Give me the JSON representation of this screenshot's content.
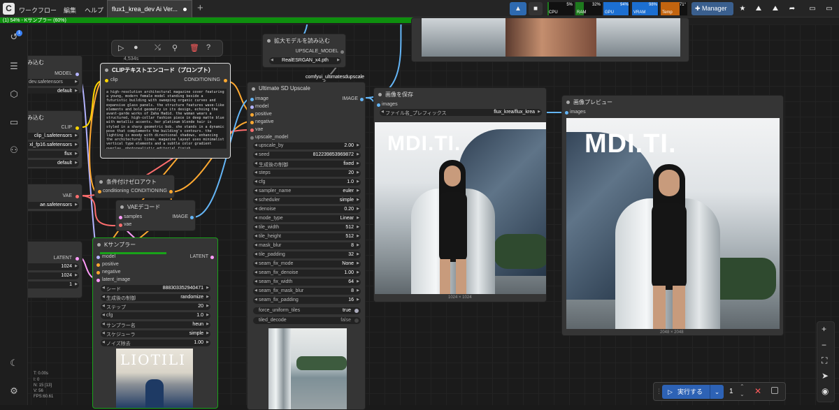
{
  "menu": {
    "app_logo": "C",
    "items": [
      "ワークフロー",
      "編集",
      "ヘルプ"
    ]
  },
  "tab": {
    "title": "flux1_krea_dev Ai Ver..."
  },
  "monitors": [
    {
      "label": "CPU",
      "pct": "5%",
      "color": "#1e7a1e"
    },
    {
      "label": "RAM",
      "pct": "32%",
      "color": "#1e7a1e"
    },
    {
      "label": "GPU",
      "pct": "94%",
      "color": "#1c6fd1"
    },
    {
      "label": "VRAM",
      "pct": "98%",
      "color": "#1c6fd1"
    },
    {
      "label": "Temp",
      "pct": "71°",
      "color": "#c2640f"
    }
  ],
  "manager": {
    "label": "Manager"
  },
  "progress": {
    "text": "(1) 54% - Kサンプラー (60%)",
    "value": 0.54
  },
  "stats": [
    "T: 0.00s",
    "I: 0",
    "N: 15 [13]",
    "V: 56",
    "FPS:60.61"
  ],
  "sidebar": {
    "badge": "1"
  },
  "canvas": {
    "edge_label": "comfyui_ultimatesdupscale",
    "clip_badge": "4,534s",
    "left_nodes": {
      "n1": {
        "title": "み込む",
        "port": "MODEL",
        "w1": "dev.safetensors",
        "w2": "default"
      },
      "n2": {
        "title": "み込む",
        "port": "CLIP",
        "w1": "clip_l.safetensors",
        "w2": "xl_fp16.safetensors",
        "w3": "flux",
        "w4": "default"
      },
      "n3": {
        "port": "VAE",
        "w1": "ae.safetensors"
      },
      "n4": {
        "port": "LATENT",
        "w1": "1024",
        "w2": "1024",
        "w3": "1"
      }
    },
    "clip_node": {
      "title": "CLIPテキストエンコード（プロンプト）",
      "in": "clip",
      "out": "CONDITIONING",
      "text": "a high-resolution architectural magazine cover featuring a young, modern female model standing beside a futuristic building with sweeping organic curves and expansive glass panels. the structure features wave-like elements and bold geometry in its design, echoing the avant-garde works of Zaha Hadid. the woman wears a structured, high-collar fashion piece in deep matte blue with metallic accents. her platinum blonde hair is styled in a sharp geometric bob. she stands in a dynamic pose that complements the building's contours. the lighting is moody with directional shadows, enhancing the architectural lines. magazine layout uses minimalist vertical type elements and a subtle color gradient overlay. photorealistic editorial finish"
    },
    "zero_node": {
      "title": "条件付けゼロアウト",
      "in": "conditioning",
      "out": "CONDITIONING"
    },
    "vae_node": {
      "title": "VAEデコード",
      "in1": "samples",
      "in2": "vae",
      "out": "IMAGE"
    },
    "upmodel_node": {
      "title": "拡大モデルを読み込む",
      "out": "UPSCALE_MODEL",
      "value": "RealESRGAN_x4.pth"
    },
    "ksampler": {
      "title": "Kサンプラー",
      "ins": [
        "model",
        "positive",
        "negative",
        "latent_image"
      ],
      "out": "LATENT",
      "widgets": [
        {
          "l": "シード",
          "v": "888303352940471"
        },
        {
          "l": "生成後の制御",
          "v": "randomize"
        },
        {
          "l": "ステップ",
          "v": "20"
        },
        {
          "l": "cfg",
          "v": "1.0"
        },
        {
          "l": "サンプラー名",
          "v": "heun"
        },
        {
          "l": "スケジューラ",
          "v": "simple"
        },
        {
          "l": "ノイズ除去",
          "v": "1.00"
        }
      ],
      "preview_text": "LIOTILI"
    },
    "usd": {
      "title": "Ultimate SD Upscale",
      "ins": [
        "image",
        "model",
        "positive",
        "negative",
        "vae",
        "upscale_model"
      ],
      "out": "IMAGE",
      "widgets": [
        {
          "l": "upscale_by",
          "v": "2.00"
        },
        {
          "l": "seed",
          "v": "812239853969872"
        },
        {
          "l": "生成後の制御",
          "v": "fixed"
        },
        {
          "l": "steps",
          "v": "20"
        },
        {
          "l": "cfg",
          "v": "1.0"
        },
        {
          "l": "sampler_name",
          "v": "euler"
        },
        {
          "l": "scheduler",
          "v": "simple"
        },
        {
          "l": "denoise",
          "v": "0.20"
        },
        {
          "l": "mode_type",
          "v": "Linear"
        },
        {
          "l": "tile_width",
          "v": "512"
        },
        {
          "l": "tile_height",
          "v": "512"
        },
        {
          "l": "mask_blur",
          "v": "8"
        },
        {
          "l": "tile_padding",
          "v": "32"
        },
        {
          "l": "seam_fix_mode",
          "v": "None"
        },
        {
          "l": "seam_fix_denoise",
          "v": "1.00"
        },
        {
          "l": "seam_fix_width",
          "v": "64"
        },
        {
          "l": "seam_fix_mask_blur",
          "v": "8"
        },
        {
          "l": "seam_fix_padding",
          "v": "16"
        }
      ],
      "toggles": [
        {
          "l": "force_uniform_tiles",
          "v": "true"
        },
        {
          "l": "tiled_decode",
          "v": "false"
        }
      ]
    },
    "save_node": {
      "title": "画像を保存",
      "in": "images",
      "prefix_label": "ファイル名_プレフィックス",
      "prefix_value": "flux_krea/flux_krea",
      "caption": "1024 × 1024",
      "cover_text": "MDI.TI."
    },
    "preview_node": {
      "title": "画像プレビュー",
      "in": "images",
      "caption": "2048 × 2048",
      "cover_text": "MDI.TI."
    }
  },
  "run": {
    "label": "実行する",
    "count": "1"
  }
}
